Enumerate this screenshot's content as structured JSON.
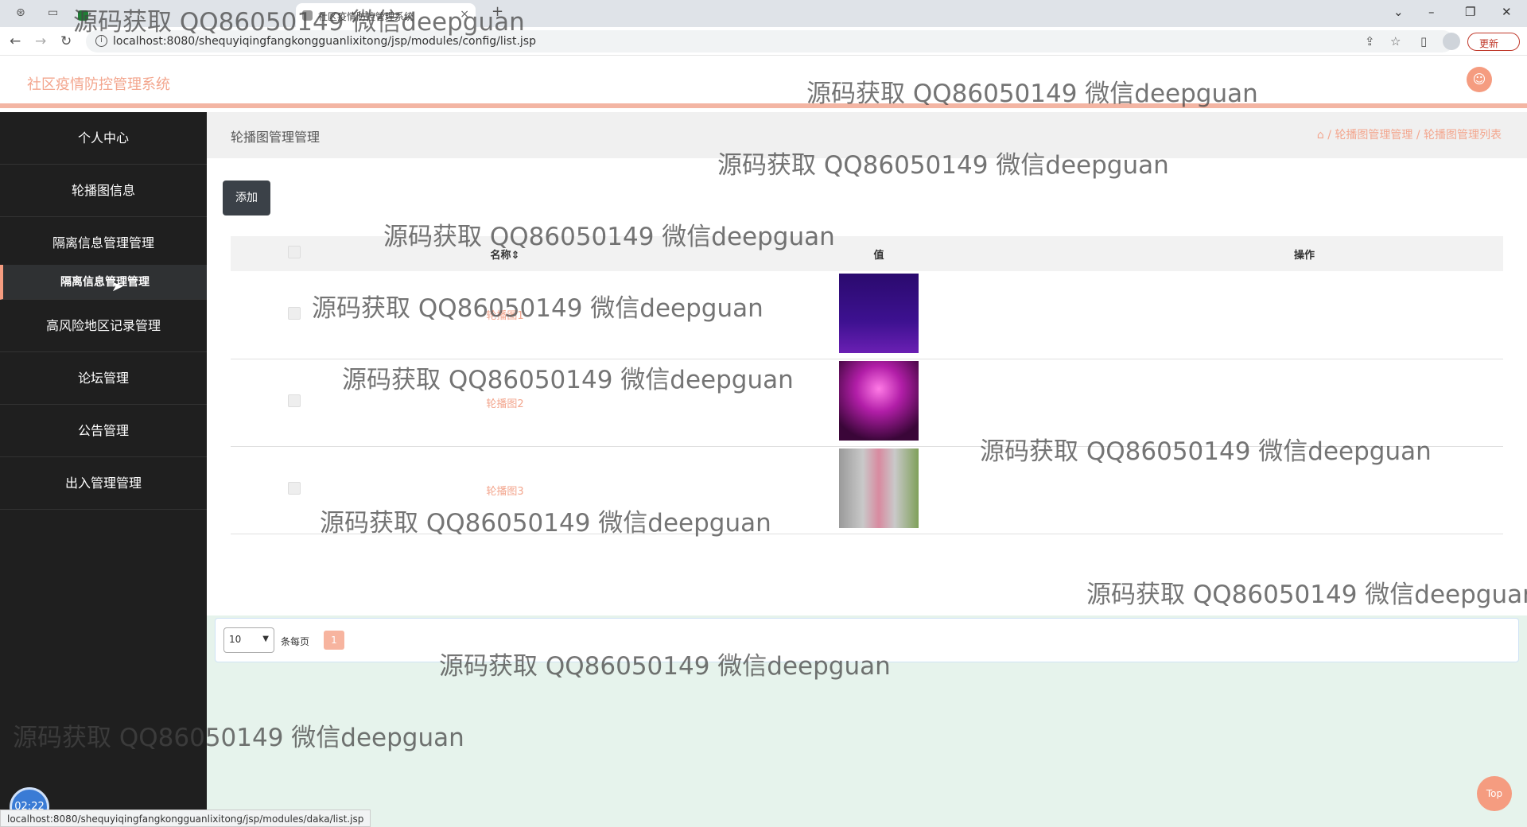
{
  "browser": {
    "tabs": [
      {
        "title": "",
        "active": false
      },
      {
        "title": "社区疫情防控管理系统",
        "active": true
      }
    ],
    "new_tab": "+",
    "url": "localhost:8080/shequyiqingfangkongguanlixitong/jsp/modules/config/list.jsp",
    "update_label": "更新",
    "status_url": "localhost:8080/shequyiqingfangkongguanlixitong/jsp/modules/daka/list.jsp"
  },
  "app": {
    "title": "社区疫情防控管理系统",
    "accent": "#f59c80"
  },
  "sidebar": {
    "items": [
      {
        "label": "个人中心"
      },
      {
        "label": "轮播图信息"
      },
      {
        "label": "隔离信息管理管理"
      },
      {
        "label": "隔离信息管理管理",
        "active": true
      },
      {
        "label": "高风险地区记录管理"
      },
      {
        "label": "论坛管理"
      },
      {
        "label": "公告管理"
      },
      {
        "label": "出入管理管理"
      }
    ]
  },
  "breadcrumb": {
    "title": "轮播图管理管理",
    "path": "/ 轮播图管理管理 / 轮播图管理列表"
  },
  "toolbar": {
    "add_label": "添加"
  },
  "table": {
    "columns": [
      "名称⇕",
      "值",
      "操作"
    ],
    "rows": [
      {
        "name": "轮播图1",
        "image": "purple-light"
      },
      {
        "name": "轮播图2",
        "image": "pink-fireworks"
      },
      {
        "name": "轮播图3",
        "image": "stone-door"
      }
    ]
  },
  "pager": {
    "page_size": "10",
    "per_page_label": "条每页",
    "current_page": "1"
  },
  "top_button": "Top",
  "clock": "02:22",
  "watermark": "源码获取 QQ86050149 微信deepguan"
}
